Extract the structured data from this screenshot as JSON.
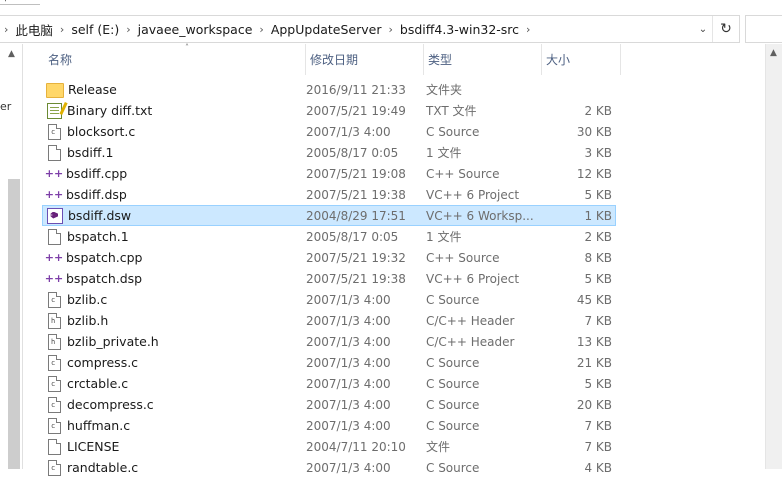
{
  "address_bar": {
    "crumbs": [
      "此电脑",
      "self (E:)",
      "javaee_workspace",
      "AppUpdateServer",
      "bsdiff4.3-win32-src"
    ]
  },
  "nav_pane": {
    "fragment_text": "er"
  },
  "columns": {
    "name": "名称",
    "date": "修改日期",
    "type": "类型",
    "size": "大小"
  },
  "icons": {
    "folder": "folder-icon",
    "text": "text-file-icon",
    "document": "document-icon",
    "cpp_source": "cpp-source-icon",
    "vs_workspace": "visual-studio-icon"
  },
  "colors": {
    "selection": "#cce8ff",
    "selection_border": "#99d1ff",
    "folder": "#ffd769",
    "header_text": "#4d6082"
  },
  "files": [
    {
      "name": "Release",
      "date": "2016/9/11 21:33",
      "type": "文件夹",
      "size": "",
      "icon": "folder",
      "glyph": ""
    },
    {
      "name": "Binary diff.txt",
      "date": "2007/5/21 19:49",
      "type": "TXT 文件",
      "size": "2 KB",
      "icon": "text",
      "glyph": ""
    },
    {
      "name": "blocksort.c",
      "date": "2007/1/3 4:00",
      "type": "C Source",
      "size": "30 KB",
      "icon": "document",
      "glyph": "c"
    },
    {
      "name": "bsdiff.1",
      "date": "2005/8/17 0:05",
      "type": "1 文件",
      "size": "3 KB",
      "icon": "document",
      "glyph": ""
    },
    {
      "name": "bsdiff.cpp",
      "date": "2007/5/21 19:08",
      "type": "C++ Source",
      "size": "12 KB",
      "icon": "cpp_source",
      "glyph": "++"
    },
    {
      "name": "bsdiff.dsp",
      "date": "2007/5/21 19:38",
      "type": "VC++ 6 Project",
      "size": "5 KB",
      "icon": "cpp_source",
      "glyph": "++"
    },
    {
      "name": "bsdiff.dsw",
      "date": "2004/8/29 17:51",
      "type": "VC++ 6 Worksp...",
      "size": "1 KB",
      "icon": "vs_workspace",
      "glyph": "",
      "selected": true
    },
    {
      "name": "bspatch.1",
      "date": "2005/8/17 0:05",
      "type": "1 文件",
      "size": "2 KB",
      "icon": "document",
      "glyph": ""
    },
    {
      "name": "bspatch.cpp",
      "date": "2007/5/21 19:32",
      "type": "C++ Source",
      "size": "8 KB",
      "icon": "cpp_source",
      "glyph": "++"
    },
    {
      "name": "bspatch.dsp",
      "date": "2007/5/21 19:38",
      "type": "VC++ 6 Project",
      "size": "5 KB",
      "icon": "cpp_source",
      "glyph": "++"
    },
    {
      "name": "bzlib.c",
      "date": "2007/1/3 4:00",
      "type": "C Source",
      "size": "45 KB",
      "icon": "document",
      "glyph": "c"
    },
    {
      "name": "bzlib.h",
      "date": "2007/1/3 4:00",
      "type": "C/C++ Header",
      "size": "7 KB",
      "icon": "document",
      "glyph": "h"
    },
    {
      "name": "bzlib_private.h",
      "date": "2007/1/3 4:00",
      "type": "C/C++ Header",
      "size": "13 KB",
      "icon": "document",
      "glyph": "h"
    },
    {
      "name": "compress.c",
      "date": "2007/1/3 4:00",
      "type": "C Source",
      "size": "21 KB",
      "icon": "document",
      "glyph": "c"
    },
    {
      "name": "crctable.c",
      "date": "2007/1/3 4:00",
      "type": "C Source",
      "size": "5 KB",
      "icon": "document",
      "glyph": "c"
    },
    {
      "name": "decompress.c",
      "date": "2007/1/3 4:00",
      "type": "C Source",
      "size": "20 KB",
      "icon": "document",
      "glyph": "c"
    },
    {
      "name": "huffman.c",
      "date": "2007/1/3 4:00",
      "type": "C Source",
      "size": "7 KB",
      "icon": "document",
      "glyph": "c"
    },
    {
      "name": "LICENSE",
      "date": "2004/7/11 20:10",
      "type": "文件",
      "size": "7 KB",
      "icon": "document",
      "glyph": ""
    },
    {
      "name": "randtable.c",
      "date": "2007/1/3 4:00",
      "type": "C Source",
      "size": "4 KB",
      "icon": "document",
      "glyph": "c"
    }
  ]
}
